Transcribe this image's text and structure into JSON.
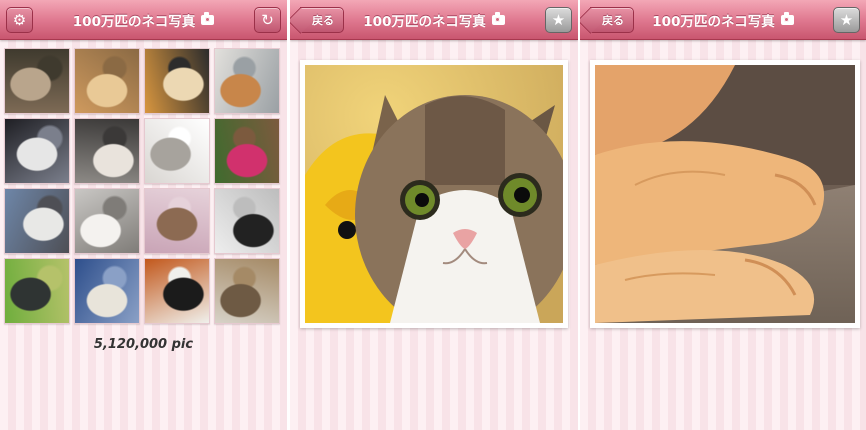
{
  "app": {
    "title": "100万匹のネコ写真"
  },
  "screens": [
    {
      "title": "100万匹のネコ写真",
      "left_button_icon": "gear-icon",
      "right_button_icon": "refresh-icon",
      "count_label": "5,120,000 pic",
      "thumbnails": [
        {
          "subject": "tabby kitten on grass",
          "colors": [
            "#7d6a55",
            "#b9a58c",
            "#3f3a2e"
          ]
        },
        {
          "subject": "orange cat lying",
          "colors": [
            "#cf9a5e",
            "#e9c996",
            "#8b6a44"
          ]
        },
        {
          "subject": "cat on keyboard",
          "colors": [
            "#d8963f",
            "#ecd8b3",
            "#2c2c2c"
          ]
        },
        {
          "subject": "orange cat on floor",
          "colors": [
            "#e2e0dc",
            "#c8864a",
            "#9aa0a4"
          ]
        },
        {
          "subject": "black and white cat",
          "colors": [
            "#1f1f24",
            "#e6e6e6",
            "#7b7f8c"
          ]
        },
        {
          "subject": "yawning cat",
          "colors": [
            "#8d8a86",
            "#e9e3dc",
            "#3b3938"
          ]
        },
        {
          "subject": "two white kittens",
          "colors": [
            "#d9d6d2",
            "#a7a39d",
            "#ffffff"
          ]
        },
        {
          "subject": "cat in flowers",
          "colors": [
            "#3f6b2e",
            "#d1316d",
            "#7c5a3e"
          ]
        },
        {
          "subject": "grey and white cat",
          "colors": [
            "#6e86a8",
            "#e8e8e6",
            "#4e4f55"
          ]
        },
        {
          "subject": "white cat lying",
          "colors": [
            "#c9c7c4",
            "#f4f2ef",
            "#7f7c78"
          ]
        },
        {
          "subject": "tabby cat on pink",
          "colors": [
            "#c9a4b6",
            "#8c6a52",
            "#e6d2da"
          ]
        },
        {
          "subject": "black and white kitten",
          "colors": [
            "#eeeeee",
            "#222222",
            "#bdbdbd"
          ]
        },
        {
          "subject": "dark longhair cat",
          "colors": [
            "#6fae3d",
            "#2f3433",
            "#b5c26a"
          ]
        },
        {
          "subject": "cat on blue pattern",
          "colors": [
            "#2e4f8c",
            "#e8e4da",
            "#8aa0c6"
          ]
        },
        {
          "subject": "tuxedo cat with flowers",
          "colors": [
            "#c2581c",
            "#1b1b1b",
            "#f0f0ec"
          ]
        },
        {
          "subject": "tabby kitten",
          "colors": [
            "#d7d2c8",
            "#6e5a44",
            "#a58a66"
          ]
        }
      ]
    },
    {
      "title": "100万匹のネコ写真",
      "back_label": "戻る",
      "right_button_icon": "star-icon",
      "photo": {
        "subject": "tabby and white cat with yellow toy",
        "colors": [
          "#e8c66a",
          "#f3cf2c",
          "#6d5a44"
        ]
      }
    },
    {
      "title": "100万匹のネコ写真",
      "back_label": "戻る",
      "right_button_icon": "star-icon",
      "photo": {
        "subject": "orange cat paws on carpet",
        "colors": [
          "#e3a86d",
          "#8e7d6f",
          "#f2d3ad"
        ]
      }
    }
  ]
}
